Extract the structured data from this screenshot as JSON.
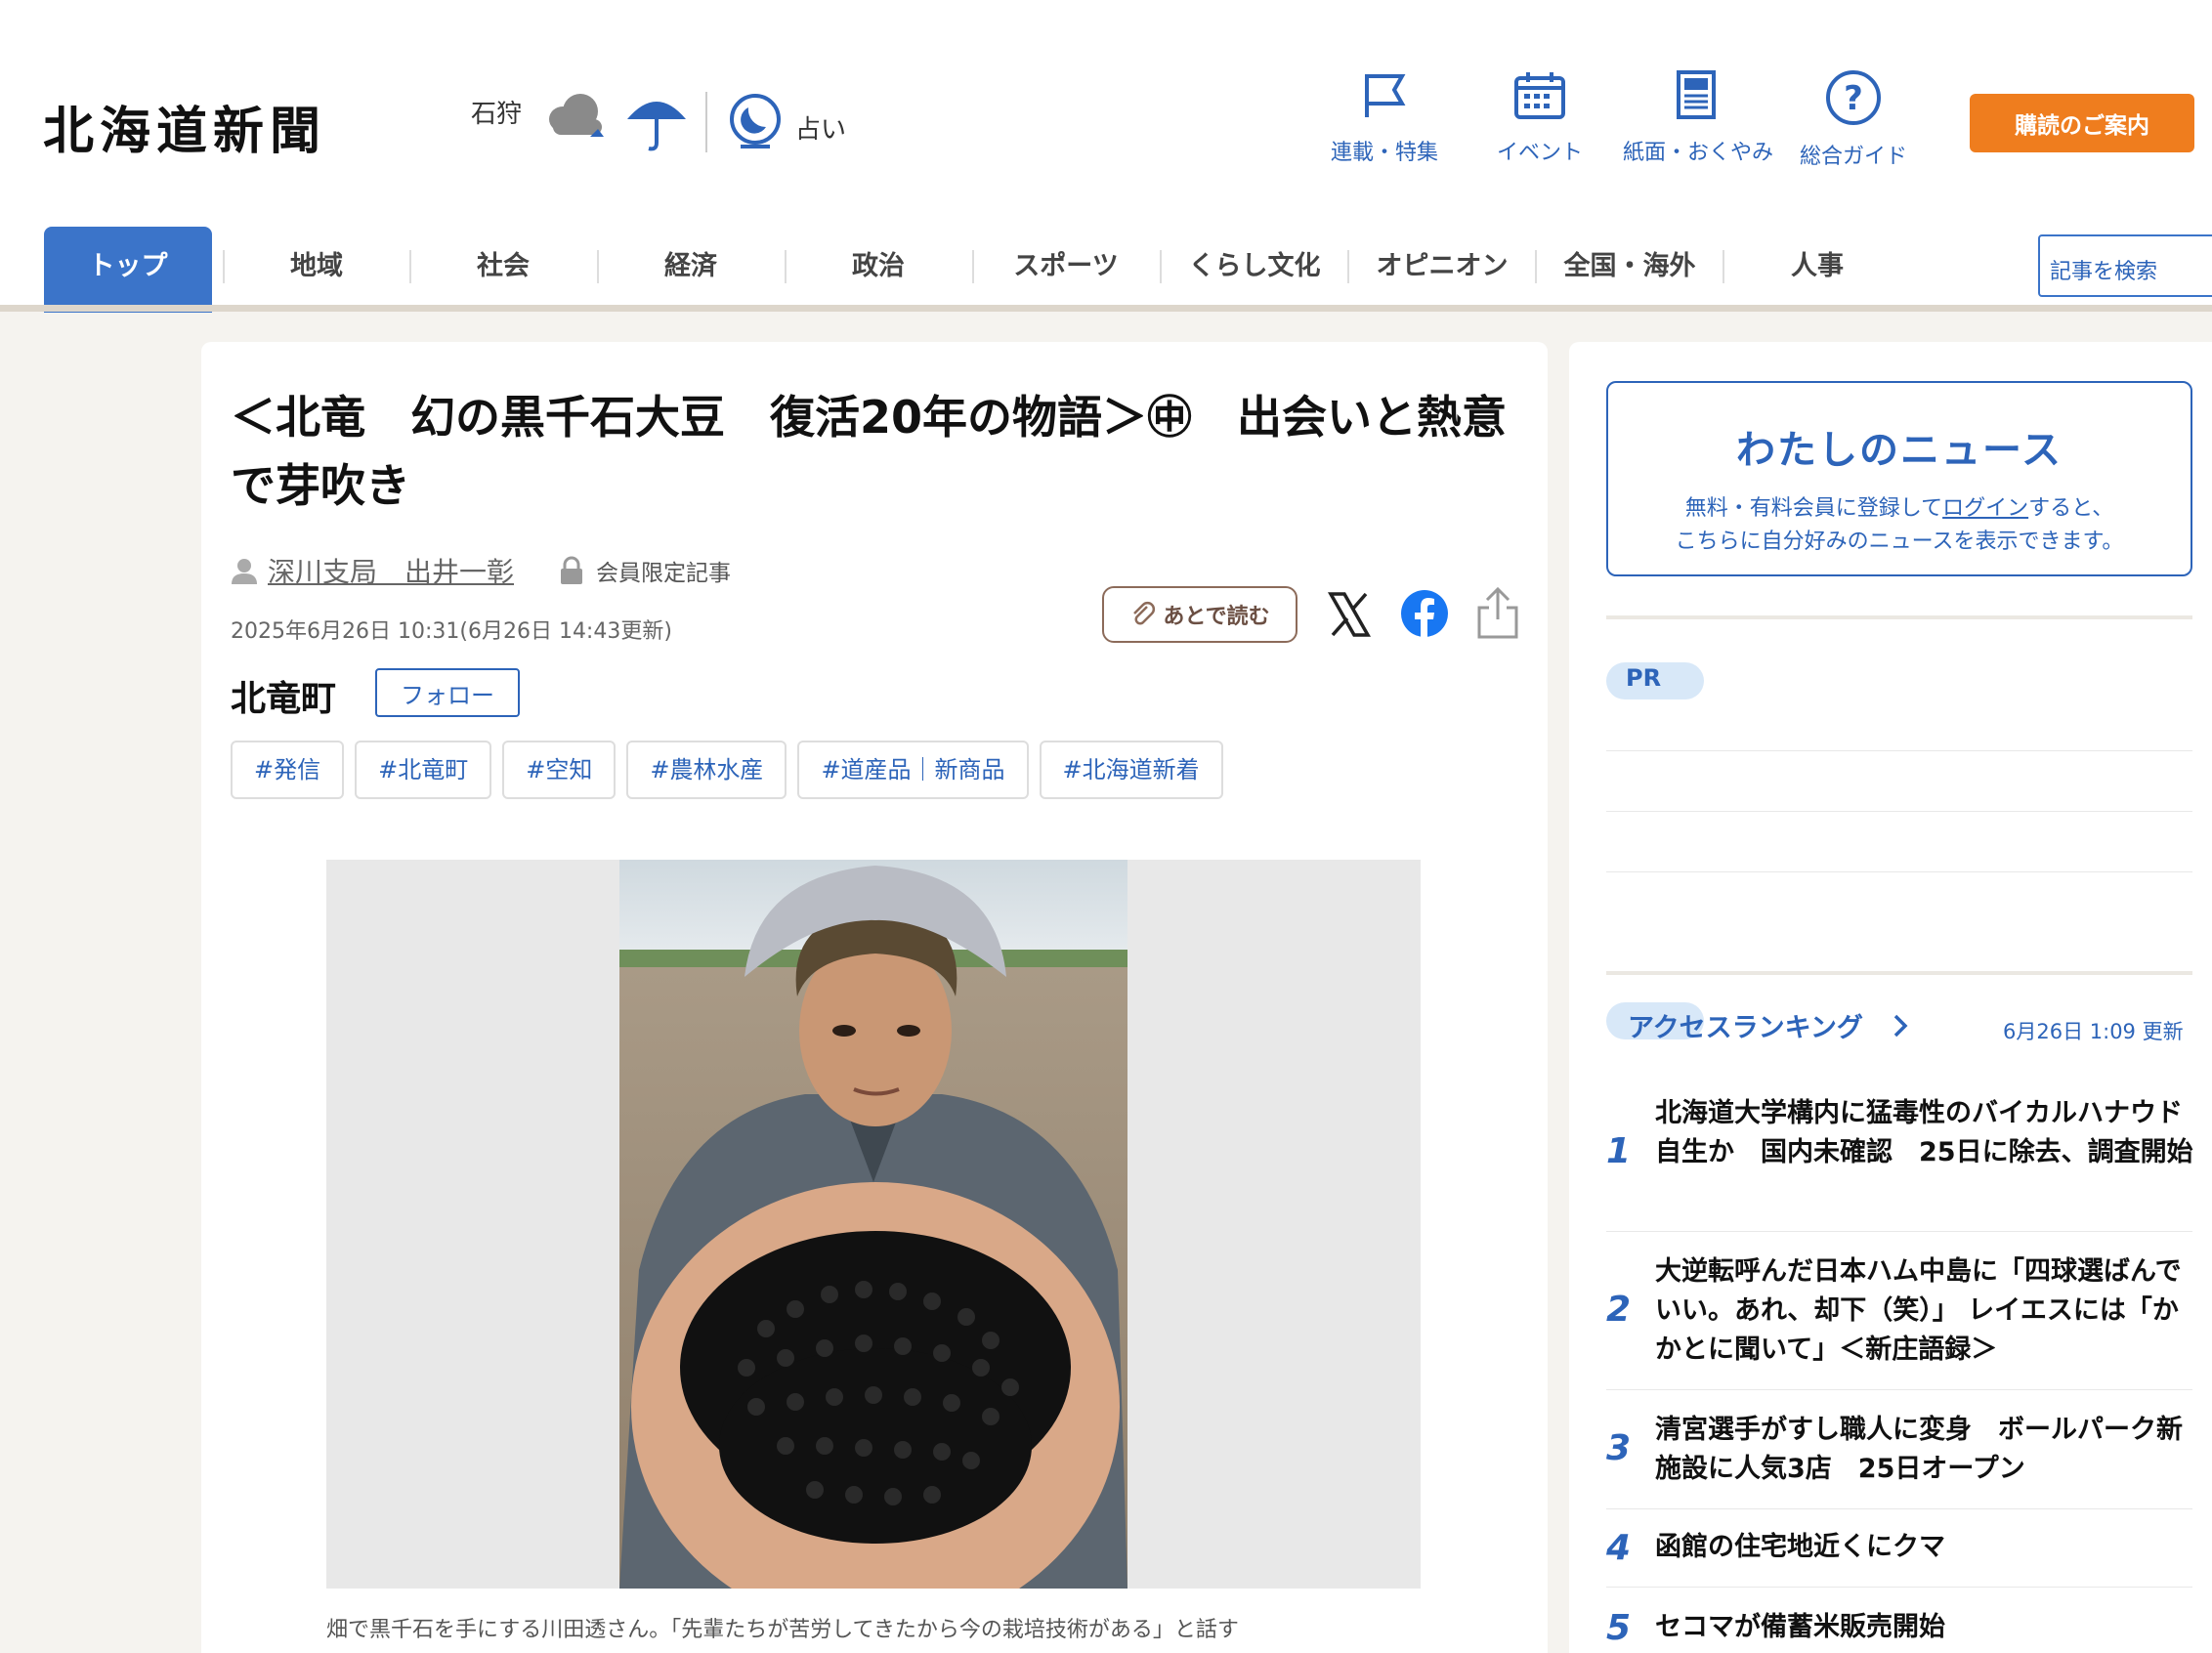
{
  "header": {
    "logo": "北海道新聞",
    "weather_region": "石狩",
    "fortune_label": "占い",
    "top_nav": [
      {
        "label": "連載・特集",
        "icon": "flag-icon"
      },
      {
        "label": "イベント",
        "icon": "calendar-icon"
      },
      {
        "label": "紙面・おくやみ",
        "icon": "newspaper-icon"
      },
      {
        "label": "総合ガイド",
        "icon": "question-icon"
      }
    ],
    "subscribe_label": "購読のご案内"
  },
  "categories": [
    "トップ",
    "地域",
    "社会",
    "経済",
    "政治",
    "スポーツ",
    "くらし文化",
    "オピニオン",
    "全国・海外",
    "人事"
  ],
  "search": {
    "placeholder": "記事を検索"
  },
  "article": {
    "title": "＜北竜　幻の黒千石大豆　復活20年の物語＞㊥　出会いと熱意で芽吹き",
    "author": "深川支局　出井一彰",
    "member_label": "会員限定記事",
    "date": "2025年6月26日 10:31(6月26日 14:43更新)",
    "read_later_label": "あとで読む",
    "area": "北竜町",
    "follow_label": "フォロー",
    "tags": [
      "#発信",
      "#北竜町",
      "#空知",
      "#農林水産",
      "#道産品｜新商品",
      "#北海道新着"
    ],
    "caption": "畑で黒千石を手にする川田透さん。「先輩たちが苦労してきたから今の栽培技術がある」と話す"
  },
  "sidebar": {
    "mynews_title": "わたしのニュース",
    "mynews_text_1": "無料・有料会員に登録して",
    "mynews_login": "ログイン",
    "mynews_text_2": "すると、",
    "mynews_text_3": "こちらに自分好みのニュースを表示できます。",
    "pr_label": "PR",
    "ranking_title": "アクセスランキング",
    "ranking_updated": "6月26日 1:09 更新",
    "ranking": [
      {
        "rank": "1",
        "title": "北海道大学構内に猛毒性のバイカルハナウド自生か　国内未確認　25日に除去、調査開始"
      },
      {
        "rank": "2",
        "title": "大逆転呼んだ日本ハム中島に「四球選ばんでいい。あれ、却下（笑）」 レイエスには「かかとに聞いて」＜新庄語録＞"
      },
      {
        "rank": "3",
        "title": "清宮選手がすし職人に変身　ボールパーク新施設に人気3店　25日オープン"
      },
      {
        "rank": "4",
        "title": "函館の住宅地近くにクマ"
      },
      {
        "rank": "5",
        "title": "セコマが備蓄米販売開始"
      }
    ]
  },
  "colors": {
    "accent": "#2d64b9",
    "subscribe": "#ef7d1e",
    "active_tab": "#3b74c9"
  }
}
